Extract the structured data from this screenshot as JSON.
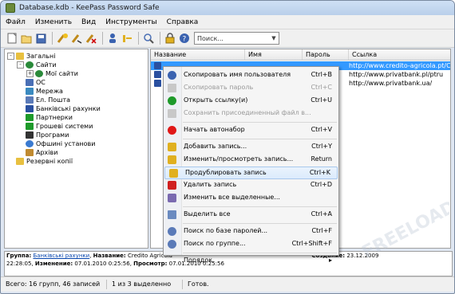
{
  "window": {
    "title": "Database.kdb - KeePass Password Safe"
  },
  "menubar": [
    "Файл",
    "Изменить",
    "Вид",
    "Инструменты",
    "Справка"
  ],
  "toolbar": {
    "search_placeholder": "Поиск...",
    "icons": [
      "new-db-icon",
      "open-icon",
      "save-icon",
      "add-entry-icon",
      "edit-entry-icon",
      "delete-entry-icon",
      "copy-user-icon",
      "copy-password-icon",
      "find-icon",
      "lock-icon",
      "help-icon"
    ]
  },
  "tree": {
    "items": [
      {
        "label": "Загальні",
        "level": 0,
        "expander": "-",
        "icon": "folder-icon"
      },
      {
        "label": "Сайти",
        "level": 1,
        "expander": "-",
        "icon": "web-icon"
      },
      {
        "label": "Мої сайти",
        "level": 2,
        "expander": "+",
        "icon": "web-icon"
      },
      {
        "label": "ОС",
        "level": 1,
        "expander": "",
        "icon": "os-icon"
      },
      {
        "label": "Мережа",
        "level": 1,
        "expander": "",
        "icon": "network-icon"
      },
      {
        "label": "Ел. Пошта",
        "level": 1,
        "expander": "",
        "icon": "mail-icon"
      },
      {
        "label": "Банківські рахунки",
        "level": 1,
        "expander": "",
        "icon": "percent-icon"
      },
      {
        "label": "Партнерки",
        "level": 1,
        "expander": "",
        "icon": "dollar-icon"
      },
      {
        "label": "Грошеві системи",
        "level": 1,
        "expander": "",
        "icon": "dollar-icon"
      },
      {
        "label": "Програми",
        "level": 1,
        "expander": "",
        "icon": "terminal-icon"
      },
      {
        "label": "Офшині установи",
        "level": 1,
        "expander": "",
        "icon": "globe-icon"
      },
      {
        "label": "Архіви",
        "level": 1,
        "expander": "",
        "icon": "archive-icon"
      },
      {
        "label": "Резервні копії",
        "level": 0,
        "expander": "",
        "icon": "backup-folder-icon"
      }
    ]
  },
  "list": {
    "columns": [
      "Название",
      "Имя",
      "Пароль",
      "Ссылка"
    ],
    "rows": [
      {
        "title": "",
        "user": "",
        "password": "",
        "url": "http://www.credito-agricola.pt/CA",
        "selected": true
      },
      {
        "title": "",
        "user": "",
        "password": "",
        "url": "http://www.privatbank.pl/ptru",
        "selected": false
      },
      {
        "title": "",
        "user": "",
        "password": "",
        "url": "http://www.privatbank.ua/",
        "selected": false
      }
    ]
  },
  "context_menu": {
    "items": [
      {
        "label": "Скопировать имя пользователя",
        "shortcut": "Ctrl+B",
        "icon": "user-copy-icon",
        "disabled": false
      },
      {
        "label": "Скопировать пароль",
        "shortcut": "Ctrl+C",
        "icon": "password-copy-icon",
        "disabled": true
      },
      {
        "label": "Открыть ссылку(и)",
        "shortcut": "Ctrl+U",
        "icon": "open-link-icon",
        "disabled": false
      },
      {
        "label": "Сохранить присоединенный файл в...",
        "shortcut": "",
        "icon": "attachment-icon",
        "disabled": true
      },
      {
        "sep": true
      },
      {
        "label": "Начать автонабор",
        "shortcut": "Ctrl+V",
        "icon": "autotype-icon",
        "disabled": false
      },
      {
        "sep": true
      },
      {
        "label": "Добавить запись...",
        "shortcut": "Ctrl+Y",
        "icon": "add-entry-icon",
        "disabled": false
      },
      {
        "label": "Изменить/просмотреть запись...",
        "shortcut": "Return",
        "icon": "edit-entry-icon",
        "disabled": false
      },
      {
        "label": "Продублировать запись",
        "shortcut": "Ctrl+K",
        "icon": "duplicate-entry-icon",
        "disabled": false,
        "highlight": true
      },
      {
        "label": "Удалить запись",
        "shortcut": "Ctrl+D",
        "icon": "delete-entry-icon",
        "disabled": false
      },
      {
        "label": "Изменить все выделенные...",
        "shortcut": "",
        "icon": "edit-all-icon",
        "disabled": false
      },
      {
        "sep": true
      },
      {
        "label": "Выделить все",
        "shortcut": "Ctrl+A",
        "icon": "select-all-icon",
        "disabled": false
      },
      {
        "sep": true
      },
      {
        "label": "Поиск по базе паролей...",
        "shortcut": "Ctrl+F",
        "icon": "search-db-icon",
        "disabled": false
      },
      {
        "label": "Поиск по группе...",
        "shortcut": "Ctrl+Shift+F",
        "icon": "search-group-icon",
        "disabled": false
      },
      {
        "sep": true
      },
      {
        "label": "Порядок",
        "shortcut": "▸",
        "icon": "",
        "disabled": false
      }
    ]
  },
  "info": {
    "group_label": "Группа:",
    "group_value": "Банківські рахунки",
    "title_label": "Название:",
    "title_value": "Credito Agricola",
    "created_label": "Создание:",
    "created_value": "23.12.2009",
    "line2_time": "22:28:05,",
    "modified_label": "Изменение:",
    "modified_value": "07.01.2010 0:25:56,",
    "viewed_label": "Просмотр:",
    "viewed_value": "07.01.2010 0:25:56"
  },
  "status": {
    "totals": "Всего: 16 групп, 46 записей",
    "selection": "1 из 3 выделенно",
    "state": "Готов."
  },
  "watermark": {
    "text": "FREELOAD"
  }
}
